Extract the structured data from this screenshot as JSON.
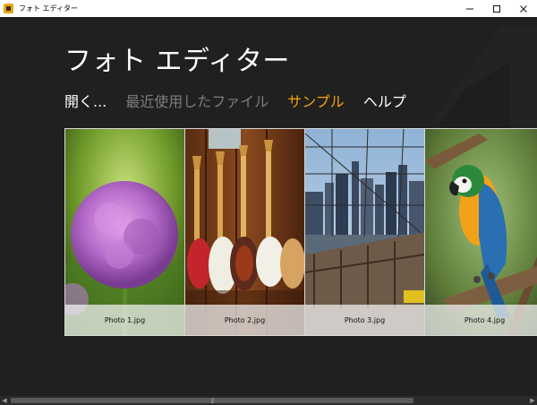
{
  "window": {
    "title": "フォト エディター",
    "icon": "app-icon"
  },
  "header": {
    "title": "フォト エディター"
  },
  "nav": {
    "items": [
      {
        "label": "開く...",
        "state": "normal"
      },
      {
        "label": "最近使用したファイル",
        "state": "disabled"
      },
      {
        "label": "サンプル",
        "state": "selected"
      },
      {
        "label": "ヘルプ",
        "state": "normal"
      }
    ]
  },
  "gallery": {
    "items": [
      {
        "caption": "Photo 1.jpg",
        "subject": "purple allium flower"
      },
      {
        "caption": "Photo 2.jpg",
        "subject": "guitars on wall"
      },
      {
        "caption": "Photo 3.jpg",
        "subject": "city skyline through bridge cables"
      },
      {
        "caption": "Photo 4.jpg",
        "subject": "macaw parrot"
      }
    ]
  },
  "colors": {
    "background": "#202020",
    "accent": "#f0a500",
    "text": "#ffffff",
    "muted": "#7d7d7d"
  }
}
